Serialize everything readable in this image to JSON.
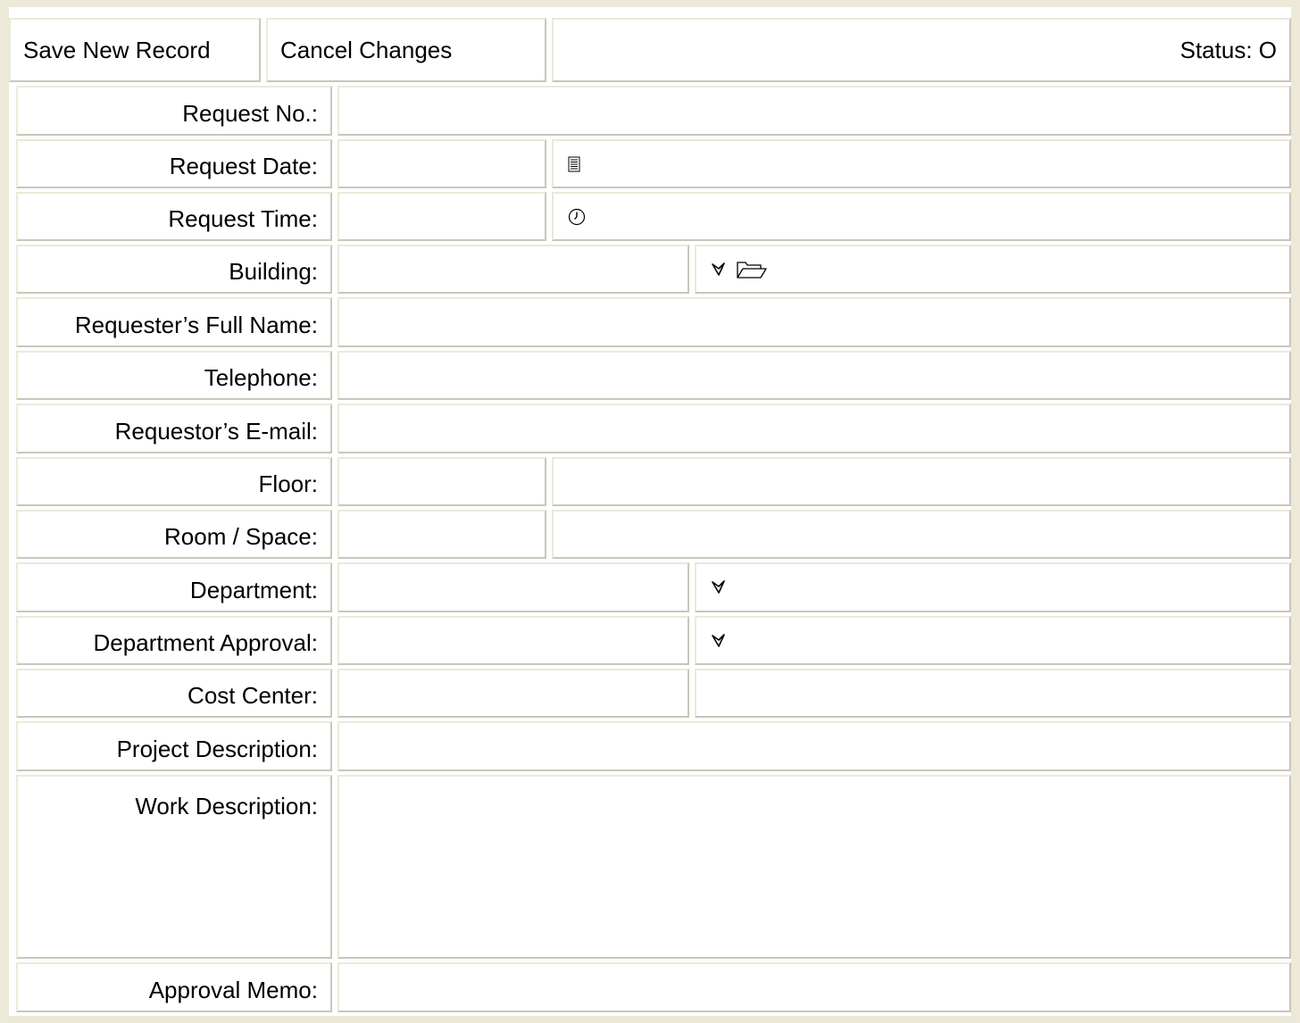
{
  "toolbar": {
    "save_label": "Save New Record",
    "cancel_label": "Cancel Changes",
    "status_text": "Status: O"
  },
  "fields": {
    "request_no": {
      "label": "Request No.:",
      "value": ""
    },
    "request_date": {
      "label": "Request Date:",
      "value": "",
      "icon": "calendar-icon"
    },
    "request_time": {
      "label": "Request Time:",
      "value": "",
      "icon": "clock-icon"
    },
    "building": {
      "label": "Building:",
      "value": "",
      "icons": [
        "select-arrow-icon",
        "folder-icon"
      ]
    },
    "requester_name": {
      "label": "Requester’s Full Name:",
      "value": ""
    },
    "telephone": {
      "label": "Telephone:",
      "value": ""
    },
    "email": {
      "label": "Requestor’s E-mail:",
      "value": ""
    },
    "floor": {
      "label": "Floor:",
      "value": ""
    },
    "room": {
      "label": "Room / Space:",
      "value": ""
    },
    "department": {
      "label": "Department:",
      "value": "",
      "icon": "select-arrow-icon"
    },
    "department_approval": {
      "label": "Department Approval:",
      "value": "",
      "icon": "select-arrow-icon"
    },
    "cost_center": {
      "label": "Cost Center:",
      "value": ""
    },
    "project_description": {
      "label": "Project Description:",
      "value": ""
    },
    "work_description": {
      "label": "Work Description:",
      "value": ""
    },
    "approval_memo": {
      "label": "Approval Memo:",
      "value": ""
    }
  },
  "colors": {
    "background": "#ece9d8",
    "border_shadow": "#c9c6b8"
  }
}
